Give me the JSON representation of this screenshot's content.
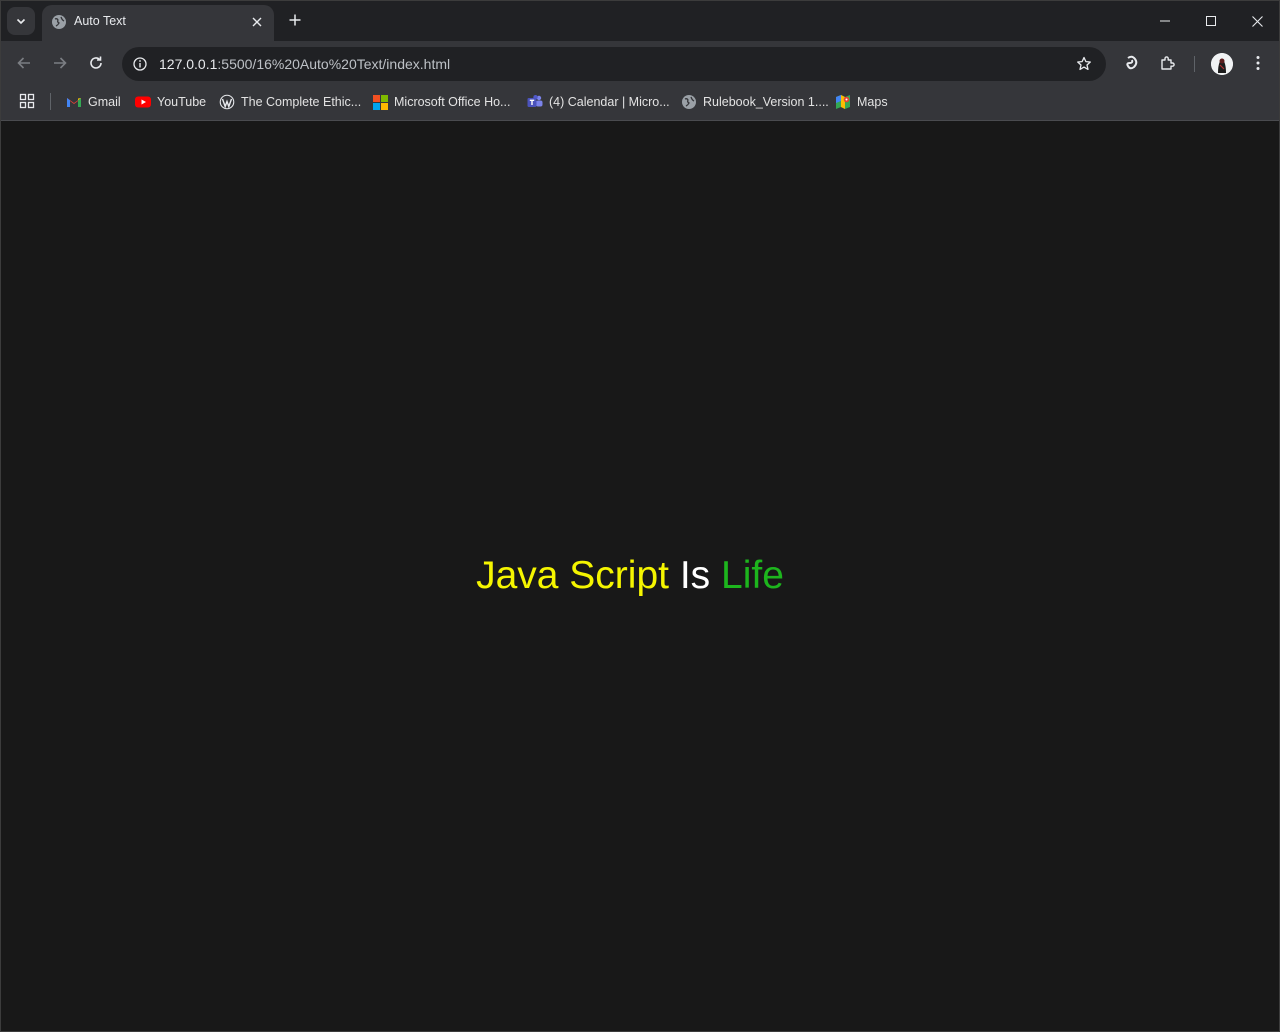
{
  "tab": {
    "title": "Auto Text"
  },
  "address_bar": {
    "url_host": "127.0.0.1",
    "url_rest": ":5500/16%20Auto%20Text/index.html"
  },
  "bookmarks": [
    {
      "label": "Gmail",
      "icon": "gmail-icon"
    },
    {
      "label": "YouTube",
      "icon": "youtube-icon"
    },
    {
      "label": "The Complete Ethic...",
      "icon": "wordpress-icon"
    },
    {
      "label": "Microsoft Office Ho...",
      "icon": "microsoft-icon"
    },
    {
      "label": "(4) Calendar | Micro...",
      "icon": "teams-icon"
    },
    {
      "label": "Rulebook_Version 1....",
      "icon": "globe-icon"
    },
    {
      "label": "Maps",
      "icon": "maps-icon"
    }
  ],
  "page": {
    "headline": {
      "part1": "Java Script",
      "part2": "Is",
      "part3": "Life"
    }
  },
  "colors": {
    "part1": "#f5f500",
    "part2": "#ffffff",
    "part3": "#1db51d",
    "background": "#181818"
  }
}
